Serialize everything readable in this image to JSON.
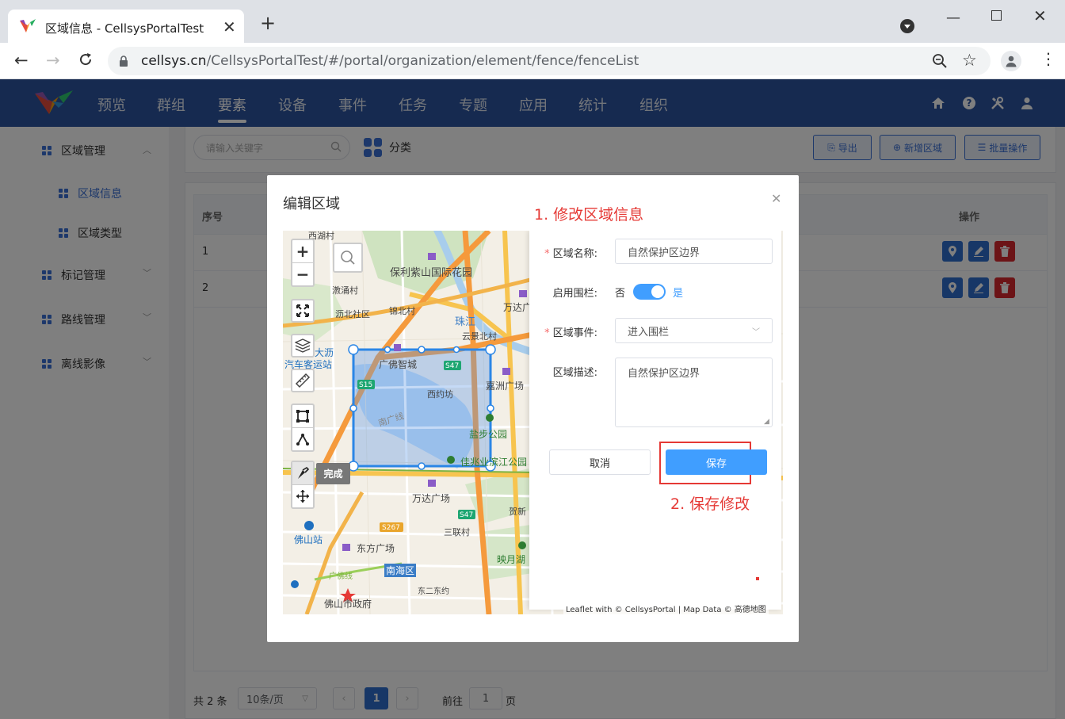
{
  "browser": {
    "tab_title": "区域信息 - CellsysPortalTest",
    "url_host": "cellsys.cn",
    "url_path": "/CellsysPortalTest/#/portal/organization/element/fence/fenceList"
  },
  "nav": {
    "items": [
      "预览",
      "群组",
      "要素",
      "设备",
      "事件",
      "任务",
      "专题",
      "应用",
      "统计",
      "组织"
    ],
    "active": "要素"
  },
  "sidebar": {
    "groups": [
      {
        "label": "区域管理",
        "children": [
          "区域信息",
          "区域类型"
        ]
      },
      {
        "label": "标记管理"
      },
      {
        "label": "路线管理"
      },
      {
        "label": "离线影像"
      }
    ]
  },
  "toolbar": {
    "search_placeholder": "请输入关键字",
    "category_label": "分类",
    "export_label": "导出",
    "add_label": "新增区域",
    "batch_label": "批量操作"
  },
  "table": {
    "col_index": "序号",
    "col_ops": "操作",
    "rows": [
      "1",
      "2"
    ]
  },
  "pagination": {
    "total": "共 2 条",
    "page_size": "10条/页",
    "current": "1",
    "goto_prefix": "前往",
    "goto_value": "1",
    "goto_suffix": "页"
  },
  "modal": {
    "title": "编辑区域",
    "annotation_1": "1. 修改区域信息",
    "annotation_2": "2. 保存修改",
    "form": {
      "name_label": "区域名称:",
      "name_value": "自然保护区边界",
      "fence_label": "启用围栏:",
      "fence_off": "否",
      "fence_on": "是",
      "fence_enabled": true,
      "event_label": "区域事件:",
      "event_value": "进入围栏",
      "desc_label": "区域描述:",
      "desc_value": "自然保护区边界",
      "cancel_label": "取消",
      "save_label": "保存"
    },
    "map": {
      "zoom_in": "+",
      "zoom_out": "−",
      "finish_label": "完成",
      "attribution": "Leaflet with © CellsysPortal | Map Data © 高德地图",
      "labels": [
        "西湖村",
        "保利紫山国际花园",
        "漖涌村",
        "锦北村",
        "珠江",
        "万达广场",
        "云景北村",
        "沥北社区",
        "大沥",
        "汽车客运站",
        "广佛智城",
        "西约坊",
        "嘉洲广场",
        "南广线",
        "盐步公园",
        "佳兆业滨江公园",
        "万达广场",
        "贺新",
        "S267",
        "三联村",
        "佛山站",
        "东方广场",
        "南海区",
        "映月湖",
        "佛山市政府",
        "广佛线",
        "东二东约",
        "S15",
        "S47",
        "S47"
      ]
    }
  },
  "colors": {
    "nav_bg": "#2d55a0",
    "accent": "#3a70d6",
    "save_button": "#409eff",
    "switch_on": "#409eff",
    "annotation": "#e53935",
    "delete_button": "#d9282f"
  }
}
